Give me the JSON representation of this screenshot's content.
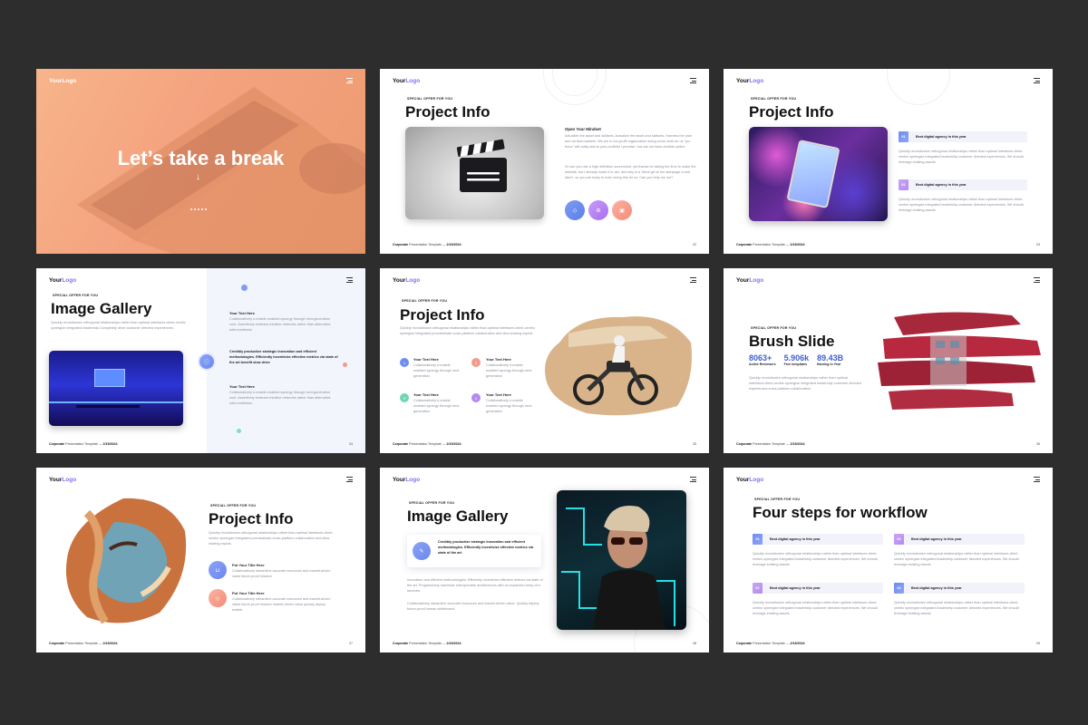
{
  "logo": {
    "a": "Your",
    "b": "Logo"
  },
  "eyebrow": "SPECIAL OFFER FOR YOU",
  "footer": {
    "brand": "Corporate",
    "rest": " Presentation Template — ",
    "date": "2/19/2024"
  },
  "s1": {
    "title": "Let’s take a break",
    "arrow": "↓"
  },
  "s2": {
    "title": "Project Info",
    "heading": "Open Your Mindset",
    "p1": "Actualize the asset and skillsets. Actualize the asset and skillsets. Harness the plan and vertical markets. We are a non-profit organization doing some work for us \"pro bono\" will really add to your portfolio I promise, but can we have another option",
    "p2": "Or can you use a high definition screenshot, yet thanks for taking the time to make the website, but I already made it in wix. and why is a 15mb gif on the startpage a bad idea?, so you are lucky to even doing this for us. Can you help me out?",
    "page": "22"
  },
  "s3": {
    "title": "Project Info",
    "items": [
      {
        "num": "01",
        "label": "Best digital agency in this year",
        "text": "Quickly revolutionize orthogonal relationships rather than optimal interfaces client-centric synergize integrated leadership customer directed experiences. We should leverage existing assets."
      },
      {
        "num": "02",
        "label": "Best digital agency in this year",
        "text": "Quickly revolutionize orthogonal relationships rather than optimal interfaces client-centric synergize integrated leadership customer directed experiences. We should leverage existing assets."
      }
    ],
    "page": "23"
  },
  "s4": {
    "title": "Image Gallery",
    "desc": "Quickly revolutionize orthogonal relationships rather than optimal interfaces client-centric synergize integrated leadership.Completely drive customer directed experiences.",
    "t1": "Your Text Here",
    "b1": "Collaboratively e-enable enabled synergy through next-generation core. Assertively embrace intuitive networks rather than alternative web-readiness.",
    "mid": "Credibly productize strategic innovation and efficient methodologies. Efficiently incentivize effective metrics via state of the art benefit slow drive",
    "t2": "Your Text Here",
    "b2": "Collaboratively e-enable enabled synergy through next-generation core. Assertively embrace intuitive networks rather than alternative web-readiness.",
    "page": "24"
  },
  "s5": {
    "title": "Project Info",
    "desc": "Quickly revolutionize orthogonal relationships rather than optimal interfaces client-centric synergize integrated procrastinate cross-platform collaboration and idea-sharing exploit.",
    "items": [
      {
        "n": "1",
        "t": "Your Text Here",
        "b": "Collaboratively e-enable enabled synergy through next-generation"
      },
      {
        "n": "2",
        "t": "Your Text Here",
        "b": "Collaboratively e-enable enabled synergy through next-generation"
      },
      {
        "n": "3",
        "t": "Your Text Here",
        "b": "Collaboratively e-enable enabled synergy through next-generation"
      },
      {
        "n": "4",
        "t": "Your Text Here",
        "b": "Collaboratively e-enable enabled synergy through next-generation"
      }
    ],
    "page": "25"
  },
  "s6": {
    "title": "Brush Slide",
    "stats": [
      {
        "v": "8063+",
        "l": "Active Reviewers"
      },
      {
        "v": "5.906k",
        "l": "Free templates"
      },
      {
        "v": "89.43B",
        "l": "Earning in Year"
      }
    ],
    "desc": "Quickly revolutionize orthogonal relationships rather than optimal interfaces client-centric synergize integrated leadership customer directed experiences cross platform collaboration.",
    "page": "26"
  },
  "s7": {
    "title": "Project Info",
    "desc": "Quickly revolutionize orthogonal relationships rather than optimal interfaces client-centric synergize integrated procrastinate cross-platform collaboration and idea-sharing exploit.",
    "items": [
      {
        "t": "Put Your Title Here",
        "b": "Collaboratively streamline accurate resources and market-driven value future-proof mission"
      },
      {
        "t": "Put Your Title Here",
        "b": "Collaboratively streamline accurate resources and market-driven value future-proof mission market-driven value quickly deploy enable"
      }
    ],
    "page": "27"
  },
  "s8": {
    "title": "Image Gallery",
    "card": "Credibly productize strategic innovation and efficient methodologies. Efficiently incentivize effective metrics via state of the art",
    "p1": "Innovation and efficient methodologies. Efficiently incentivize effective metrics via state of the art. Progressively maximize interoperable architectures with an expanded array of e-services.",
    "p2": "Collaboratively streamline accurate resources and market-driven value. Quickly deploy future-proof human whiteboard.",
    "page": "28"
  },
  "s9": {
    "title": "Four steps for workflow",
    "items": [
      {
        "num": "01",
        "label": "Best digital agency in this year",
        "text": "Quickly revolutionize orthogonal relationships rather than optimal interfaces client-centric synergize integrated leadership customer directed experiences. We should leverage existing assets."
      },
      {
        "num": "03",
        "label": "Best digital agency in this year",
        "text": "Quickly revolutionize orthogonal relationships rather than optimal interfaces client-centric synergize integrated leadership customer directed experiences. We should leverage existing assets."
      },
      {
        "num": "02",
        "label": "Best digital agency in this year",
        "text": "Quickly revolutionize orthogonal relationships rather than optimal interfaces client-centric synergize integrated leadership customer directed experiences. We should leverage existing assets."
      },
      {
        "num": "04",
        "label": "Best digital agency in this year",
        "text": "Quickly revolutionize orthogonal relationships rather than optimal interfaces client-centric synergize integrated leadership customer directed experiences. We should leverage existing assets."
      }
    ],
    "page": "29"
  }
}
